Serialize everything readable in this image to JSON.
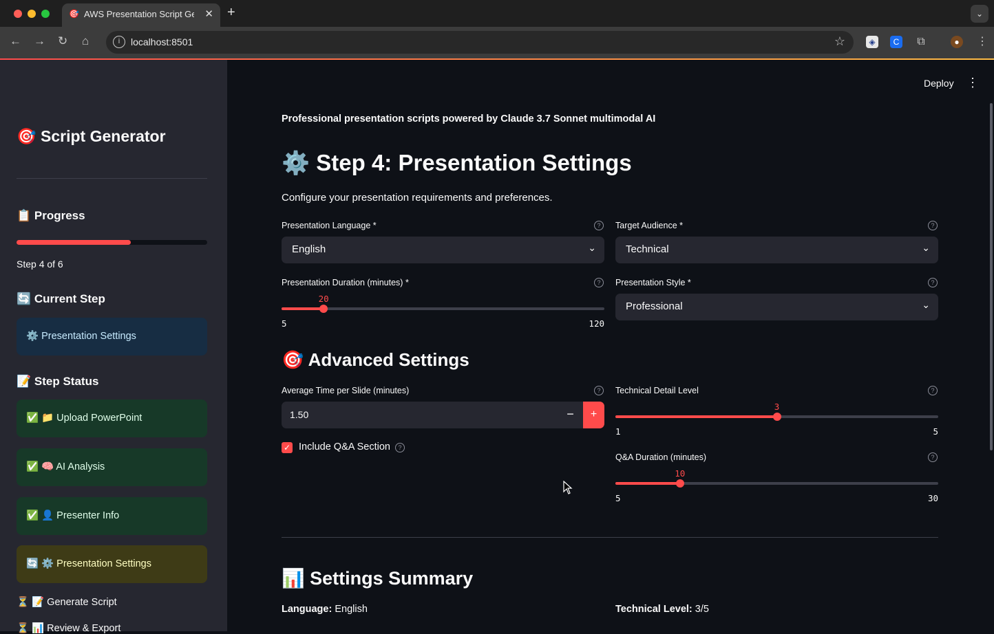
{
  "browser": {
    "tab_title": "AWS Presentation Script Gen",
    "tab_favicon": "🎯",
    "url": "localhost:8501",
    "new_tab_label": "+",
    "tab_close": "✕"
  },
  "header": {
    "deploy_label": "Deploy",
    "menu_icon": "⋮"
  },
  "sidebar": {
    "title": "🎯 Script Generator",
    "progress_heading": "📋 Progress",
    "progress_value": 0.6,
    "progress_text": "Step 4 of 6",
    "current_heading": "🔄 Current Step",
    "current_step": "⚙️ Presentation Settings",
    "status_heading": "📝 Step Status",
    "steps": [
      {
        "label": "✅ 📁 Upload PowerPoint",
        "state": "done"
      },
      {
        "label": "✅ 🧠 AI Analysis",
        "state": "done"
      },
      {
        "label": "✅ 👤 Presenter Info",
        "state": "done"
      },
      {
        "label": "🔄 ⚙️ Presentation Settings",
        "state": "current"
      },
      {
        "label": "⏳ 📝 Generate Script",
        "state": "pending"
      },
      {
        "label": "⏳ 📊 Review & Export",
        "state": "pending"
      }
    ]
  },
  "main": {
    "tagline": "Professional presentation scripts powered by Claude 3.7 Sonnet multimodal AI",
    "step_title": "⚙️ Step 4: Presentation Settings",
    "step_desc": "Configure your presentation requirements and preferences.",
    "language": {
      "label": "Presentation Language *",
      "value": "English"
    },
    "audience": {
      "label": "Target Audience *",
      "value": "Technical"
    },
    "duration": {
      "label": "Presentation Duration (minutes) *",
      "value": 20,
      "min": 5,
      "max": 120
    },
    "style": {
      "label": "Presentation Style *",
      "value": "Professional"
    },
    "advanced_title": "🎯 Advanced Settings",
    "avg_time": {
      "label": "Average Time per Slide (minutes)",
      "value": "1.50",
      "minus": "−",
      "plus": "+"
    },
    "tech_level": {
      "label": "Technical Detail Level",
      "value": 3,
      "min": 1,
      "max": 5
    },
    "qa_include": {
      "label": "Include Q&A Section",
      "checked": true
    },
    "qa_duration": {
      "label": "Q&A Duration (minutes)",
      "value": 10,
      "min": 5,
      "max": 30
    },
    "summary_title": "📊 Settings Summary",
    "summary": {
      "language_key": "Language:",
      "language_val": "English",
      "tech_key": "Technical Level:",
      "tech_val": "3/5"
    }
  },
  "colors": {
    "accent": "#ff4b4b",
    "background": "#0e1117",
    "sidebar": "#262730"
  }
}
